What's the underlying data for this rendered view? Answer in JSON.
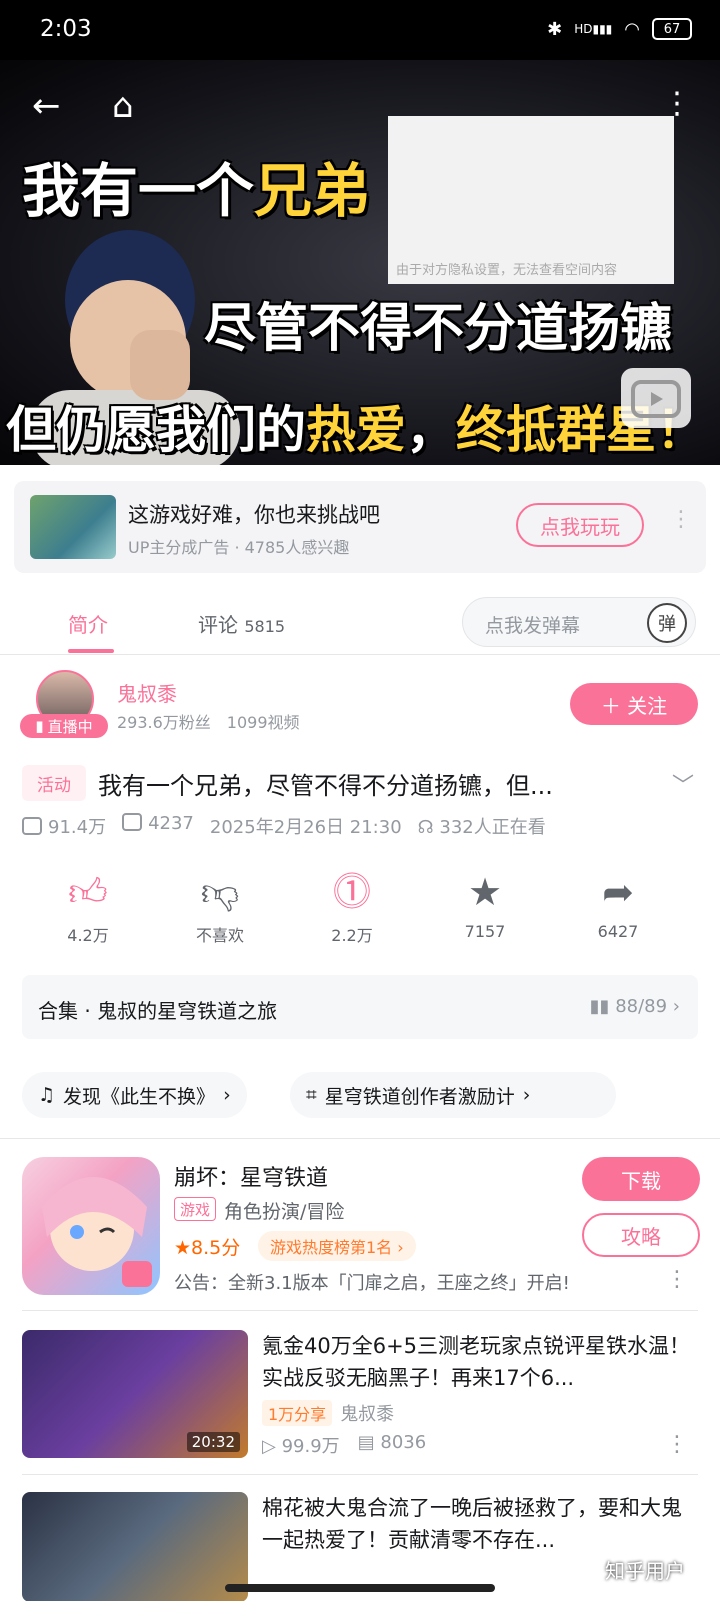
{
  "status_bar": {
    "time": "2:03",
    "battery": "67",
    "signal_label": "HD"
  },
  "video": {
    "line1_white": "我有一个",
    "line1_yellow": "兄弟",
    "line2": "尽管不得不分道扬镳",
    "line3_white": "但仍愿我们的",
    "line3_yellow": "热爱",
    "line3_white2": "，",
    "line3_yellow2": "终抵群星！",
    "privacy_text": "由于对方隐私设置，无法查看空间内容"
  },
  "ad": {
    "title": "这游戏好难，你也来挑战吧",
    "subtitle": "UP主分成广告 · 4785人感兴趣",
    "button": "点我玩玩"
  },
  "tabs": {
    "intro": "简介",
    "comments": "评论",
    "comments_count": "5815",
    "danmaku_placeholder": "点我发弹幕",
    "danmaku_icon": "弹"
  },
  "uploader": {
    "name": "鬼叔黍",
    "stats": "293.6万粉丝　1099视频",
    "live": "直播中",
    "follow": "＋ 关注"
  },
  "video_info": {
    "tag": "活动",
    "title": "我有一个兄弟，尽管不得不分道扬镳，但...",
    "plays": "91.4万",
    "danmaku": "4237",
    "date": "2025年2月26日 21:30",
    "watching": "332人正在看"
  },
  "actions": [
    {
      "icon": "thumbs-up-icon",
      "label": "4.2万"
    },
    {
      "icon": "thumbs-down-icon",
      "label": "不喜欢"
    },
    {
      "icon": "coin-icon",
      "label": "2.2万"
    },
    {
      "icon": "star-icon",
      "label": "7157"
    },
    {
      "icon": "share-icon",
      "label": "6427"
    }
  ],
  "collection": {
    "title": "合集 · 鬼叔的星穹铁道之旅",
    "progress": "88/89"
  },
  "chips": {
    "music": "发现《此生不换》",
    "topic": "星穹铁道创作者激励计"
  },
  "game": {
    "title": "崩坏：星穹铁道",
    "tag": "游戏",
    "category": "角色扮演/冒险",
    "score": "★8.5分",
    "rank": "游戏热度榜第1名 ›",
    "notice": "公告：全新3.1版本「门扉之启，王座之终」开启!",
    "download": "下载",
    "guide": "攻略"
  },
  "recommendations": [
    {
      "title": "氪金40万全6+5三测老玩家点锐评星铁水温！实战反驳无脑黑子！再来17个6...",
      "badge": "1万分享",
      "up": "鬼叔黍",
      "plays": "99.9万",
      "danmaku": "8036",
      "duration": "20:32"
    },
    {
      "title": "棉花被大鬼合流了一晚后被拯救了，要和大鬼一起热爱了！贡献清零不存在..."
    }
  ],
  "watermark": "知乎用户"
}
